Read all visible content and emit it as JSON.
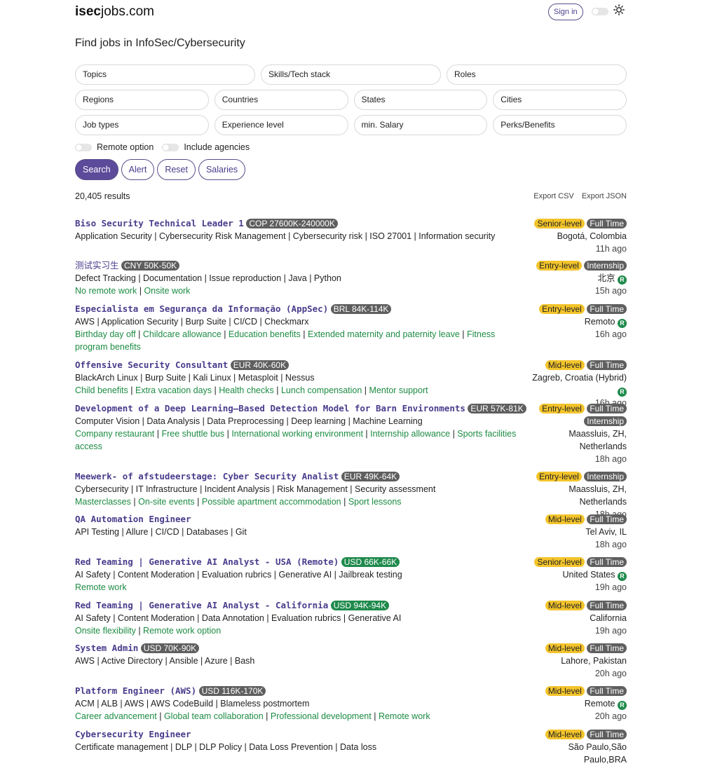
{
  "header": {
    "logo_bold": "isec",
    "logo_rest": "jobs.com",
    "signin_label": "Sign in",
    "page_title": "Find jobs in InfoSec/Cybersecurity"
  },
  "filters": {
    "row1": [
      "Topics",
      "Skills/Tech stack",
      "Roles"
    ],
    "row2": [
      "Regions",
      "Countries",
      "States",
      "Cities"
    ],
    "row3": [
      "Job types",
      "Experience level",
      "min. Salary",
      "Perks/Benefits"
    ],
    "remote_label": "Remote option",
    "agencies_label": "Include agencies"
  },
  "buttons": {
    "search": "Search",
    "alert": "Alert",
    "reset": "Reset",
    "salaries": "Salaries"
  },
  "results_count": "20,405 results",
  "exports": {
    "csv": "Export CSV",
    "json": "Export JSON"
  },
  "colors": {
    "accent": "#5b4b9a",
    "title": "#4a3c8c",
    "benefit_green": "#1d8b43",
    "salary_gray": "#5f5f5f",
    "salary_green": "#1f8a4c",
    "level_yellow": "#f3c42b"
  },
  "jobs": [
    {
      "title": "Biso Security Technical Leader 1",
      "salary": "COP 27600K-240000K",
      "salary_style": "gray",
      "tags": "Application Security | Cybersecurity Risk Management | Cybersecurity risk | ISO 27001 | Information security",
      "benefits": [],
      "level": "Senior-level",
      "type": "Full Time",
      "location": "Bogotá, Colombia",
      "remote": false,
      "time": "11h ago"
    },
    {
      "title": "测试实习生",
      "salary": "CNY 50K-50K",
      "salary_style": "gray",
      "tags": "Defect Tracking | Documentation | Issue reproduction | Java | Python",
      "benefits": [
        "No remote work",
        "Onsite work"
      ],
      "level": "Entry-level",
      "type": "Internship",
      "location": "北京",
      "remote": true,
      "time": "15h ago"
    },
    {
      "title": "Especialista em Segurança da Informação (AppSec)",
      "salary": "BRL 84K-114K",
      "salary_style": "gray",
      "tags": "AWS | Application Security | Burp Suite | CI/CD | Checkmarx",
      "benefits": [
        "Birthday day off",
        "Childcare allowance",
        "Education benefits",
        "Extended maternity and paternity leave",
        "Fitness program benefits"
      ],
      "level": "Entry-level",
      "type": "Full Time",
      "location": "Remoto",
      "remote": true,
      "time": "16h ago"
    },
    {
      "title": "Offensive Security Consultant",
      "salary": "EUR 40K-60K",
      "salary_style": "gray",
      "tags": "BlackArch Linux | Burp Suite | Kali Linux | Metasploit | Nessus",
      "benefits": [
        "Child benefits",
        "Extra vacation days",
        "Health checks",
        "Lunch compensation",
        "Mentor support"
      ],
      "level": "Mid-level",
      "type": "Full Time",
      "location": "Zagreb, Croatia (Hybrid)",
      "remote": true,
      "time": "16h ago"
    },
    {
      "title": "Development of a Deep Learning–Based Detection Model for Barn Environments",
      "salary": "EUR 57K-81K",
      "salary_style": "gray",
      "tags": "Computer Vision | Data Analysis | Data Preprocessing | Deep learning | Machine Learning",
      "benefits": [
        "Company restaurant",
        "Free shuttle bus",
        "International working environment",
        "Internship allowance",
        "Sports facilities access"
      ],
      "level": "Entry-level",
      "type": "Full Time",
      "type2": "Internship",
      "location": "Maassluis, ZH, Netherlands",
      "remote": false,
      "time": "18h ago"
    },
    {
      "title": "Meewerk- of afstudeerstage: Cyber Security Analist",
      "salary": "EUR 49K-64K",
      "salary_style": "gray",
      "tags": "Cybersecurity | IT Infrastructure | Incident Analysis | Risk Management | Security assessment",
      "benefits": [
        "Masterclasses",
        "On-site events",
        "Possible apartment accommodation",
        "Sport lessons"
      ],
      "level": "Entry-level",
      "type": "Internship",
      "location": "Maassluis, ZH, Netherlands",
      "remote": false,
      "time": "18h ago"
    },
    {
      "title": "QA Automation Engineer",
      "salary": "",
      "salary_style": "gray",
      "tags": "API Testing | Allure | CI/CD | Databases | Git",
      "benefits": [],
      "level": "Mid-level",
      "type": "Full Time",
      "location": "Tel Aviv, IL",
      "remote": false,
      "time": "18h ago"
    },
    {
      "title": "Red Teaming | Generative AI Analyst - USA (Remote)",
      "salary": "USD 66K-66K",
      "salary_style": "green",
      "tags": "AI Safety | Content Moderation | Evaluation rubrics | Generative AI | Jailbreak testing",
      "benefits": [
        "Remote work"
      ],
      "level": "Senior-level",
      "type": "Full Time",
      "location": "United States",
      "remote": true,
      "time": "19h ago"
    },
    {
      "title": "Red Teaming | Generative AI Analyst - California",
      "salary": "USD 94K-94K",
      "salary_style": "green",
      "tags": "AI Safety | Content Moderation | Data Annotation | Evaluation rubrics | Generative AI",
      "benefits": [
        "Onsite flexibility",
        "Remote work option"
      ],
      "level": "Mid-level",
      "type": "Full Time",
      "location": "California",
      "remote": false,
      "time": "19h ago"
    },
    {
      "title": "System Admin",
      "salary": "USD 70K-90K",
      "salary_style": "gray",
      "tags": "AWS | Active Directory | Ansible | Azure | Bash",
      "benefits": [],
      "level": "Mid-level",
      "type": "Full Time",
      "location": "Lahore, Pakistan",
      "remote": false,
      "time": "20h ago"
    },
    {
      "title": "Platform Engineer (AWS)",
      "salary": "USD 116K-170K",
      "salary_style": "gray",
      "tags": "ACM | ALB | AWS | AWS CodeBuild | Blameless postmortem",
      "benefits": [
        "Career advancement",
        "Global team collaboration",
        "Professional development",
        "Remote work"
      ],
      "level": "Mid-level",
      "type": "Full Time",
      "location": "Remote",
      "remote": true,
      "time": "20h ago"
    },
    {
      "title": "Cybersecurity Engineer",
      "salary": "",
      "salary_style": "gray",
      "tags": "Certificate management | DLP | DLP Policy | Data Loss Prevention | Data loss",
      "benefits": [],
      "level": "Mid-level",
      "type": "Full Time",
      "location": "São Paulo,São Paulo,BRA",
      "remote": false,
      "time": ""
    }
  ]
}
